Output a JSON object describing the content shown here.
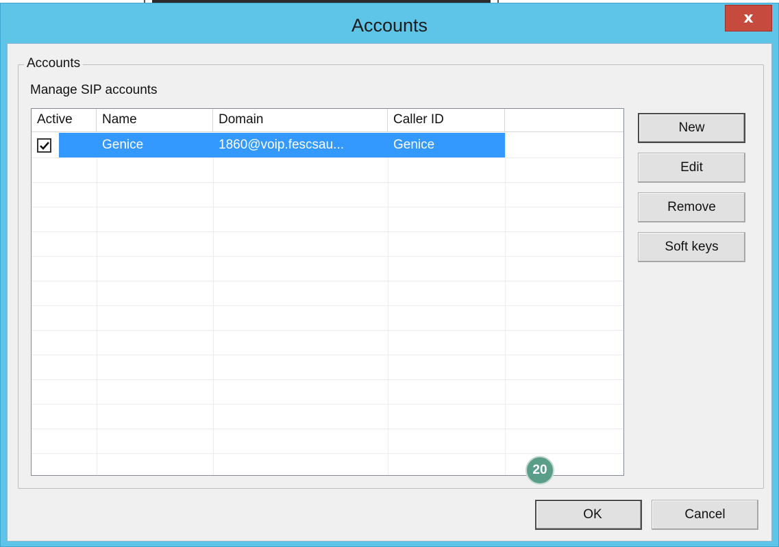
{
  "window": {
    "title": "Accounts",
    "close_label": "x"
  },
  "group": {
    "legend": "Accounts",
    "subtitle": "Manage SIP accounts"
  },
  "table": {
    "columns": [
      "Active",
      "Name",
      "Domain",
      "Caller ID"
    ],
    "rows": [
      {
        "active": true,
        "name": "Genice",
        "domain": "1860@voip.fescsau...",
        "caller_id": "Genice",
        "selected": true
      }
    ]
  },
  "side_buttons": {
    "new": "New",
    "edit": "Edit",
    "remove": "Remove",
    "soft_keys": "Soft keys"
  },
  "footer": {
    "ok": "OK",
    "cancel": "Cancel",
    "badge": "20"
  },
  "colors": {
    "titlebar": "#5ec5e9",
    "close": "#c74a3e",
    "selection": "#3399ff",
    "badge": "#5a9e8a"
  }
}
